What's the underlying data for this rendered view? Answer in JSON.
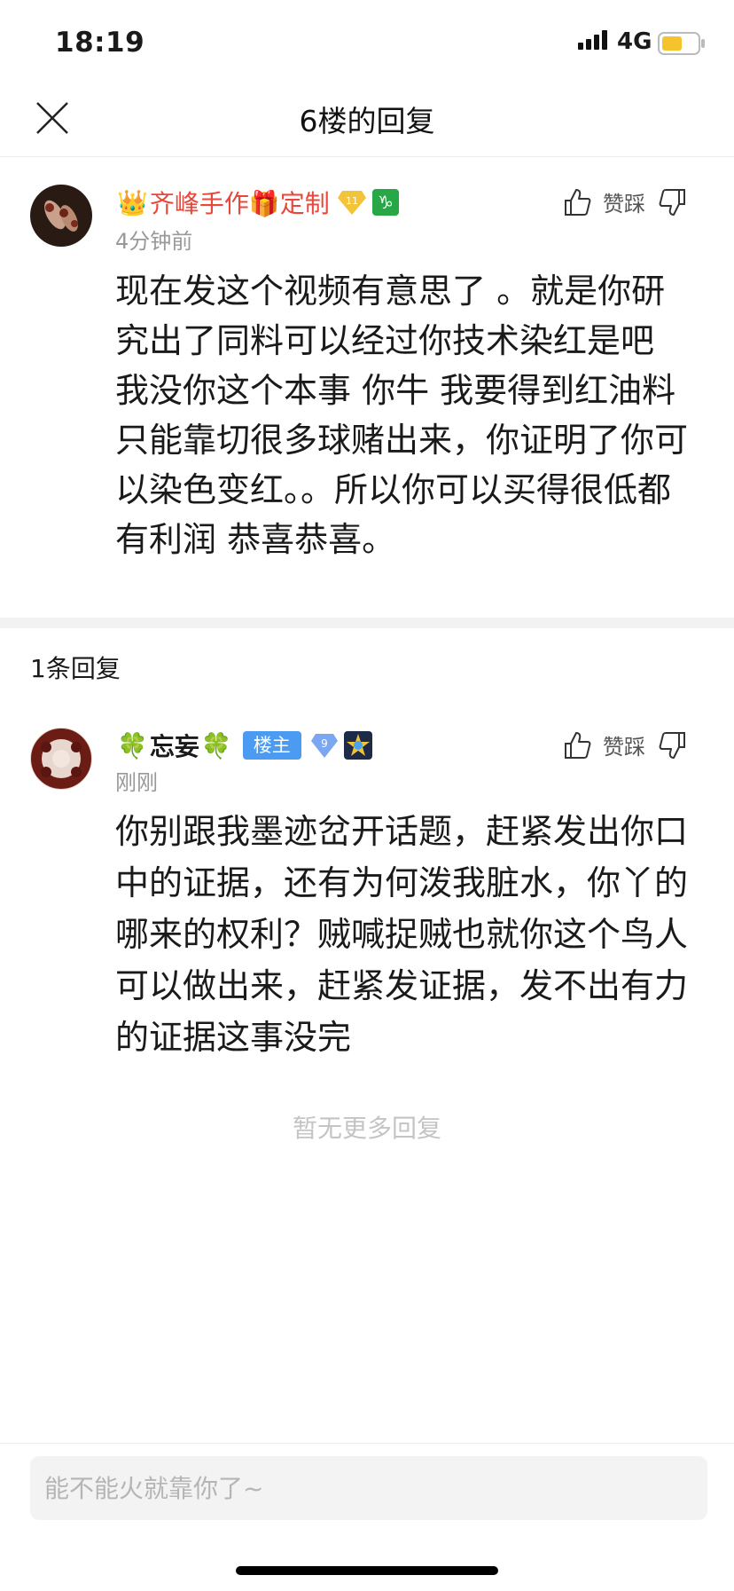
{
  "status_bar": {
    "time": "18:19",
    "network": "4G"
  },
  "nav": {
    "title": "6楼的回复"
  },
  "main_comment": {
    "username": "齐峰手作🎁定制",
    "level_badge": "11",
    "time": "4分钟前",
    "like_label": "赞",
    "dislike_label": "踩",
    "text": "现在发这个视频有意思了 。就是你研究出了同料可以经过你技术染红是吧 我没你这个本事 你牛 我要得到红油料只能靠切很多球赌出来，你证明了你可以染色变红。。所以你可以买得很低都有利润 恭喜恭喜。"
  },
  "reply_count": "1条回复",
  "reply": {
    "username": "忘妄",
    "owner_badge": "楼主",
    "level_badge": "9",
    "time": "刚刚",
    "like_label": "赞",
    "dislike_label": "踩",
    "text": "你别跟我墨迹岔开话题，赶紧发出你口中的证据，还有为何泼我脏水，你丫的哪来的权利？贼喊捉贼也就你这个鸟人可以做出来，赶紧发证据，发不出有力的证据这事没完"
  },
  "no_more_text": "暂无更多回复",
  "input": {
    "placeholder": "能不能火就靠你了~"
  },
  "colors": {
    "username_red": "#e8473b",
    "owner_badge_blue": "#4b9bf3",
    "timestamp_gray": "#999999"
  }
}
